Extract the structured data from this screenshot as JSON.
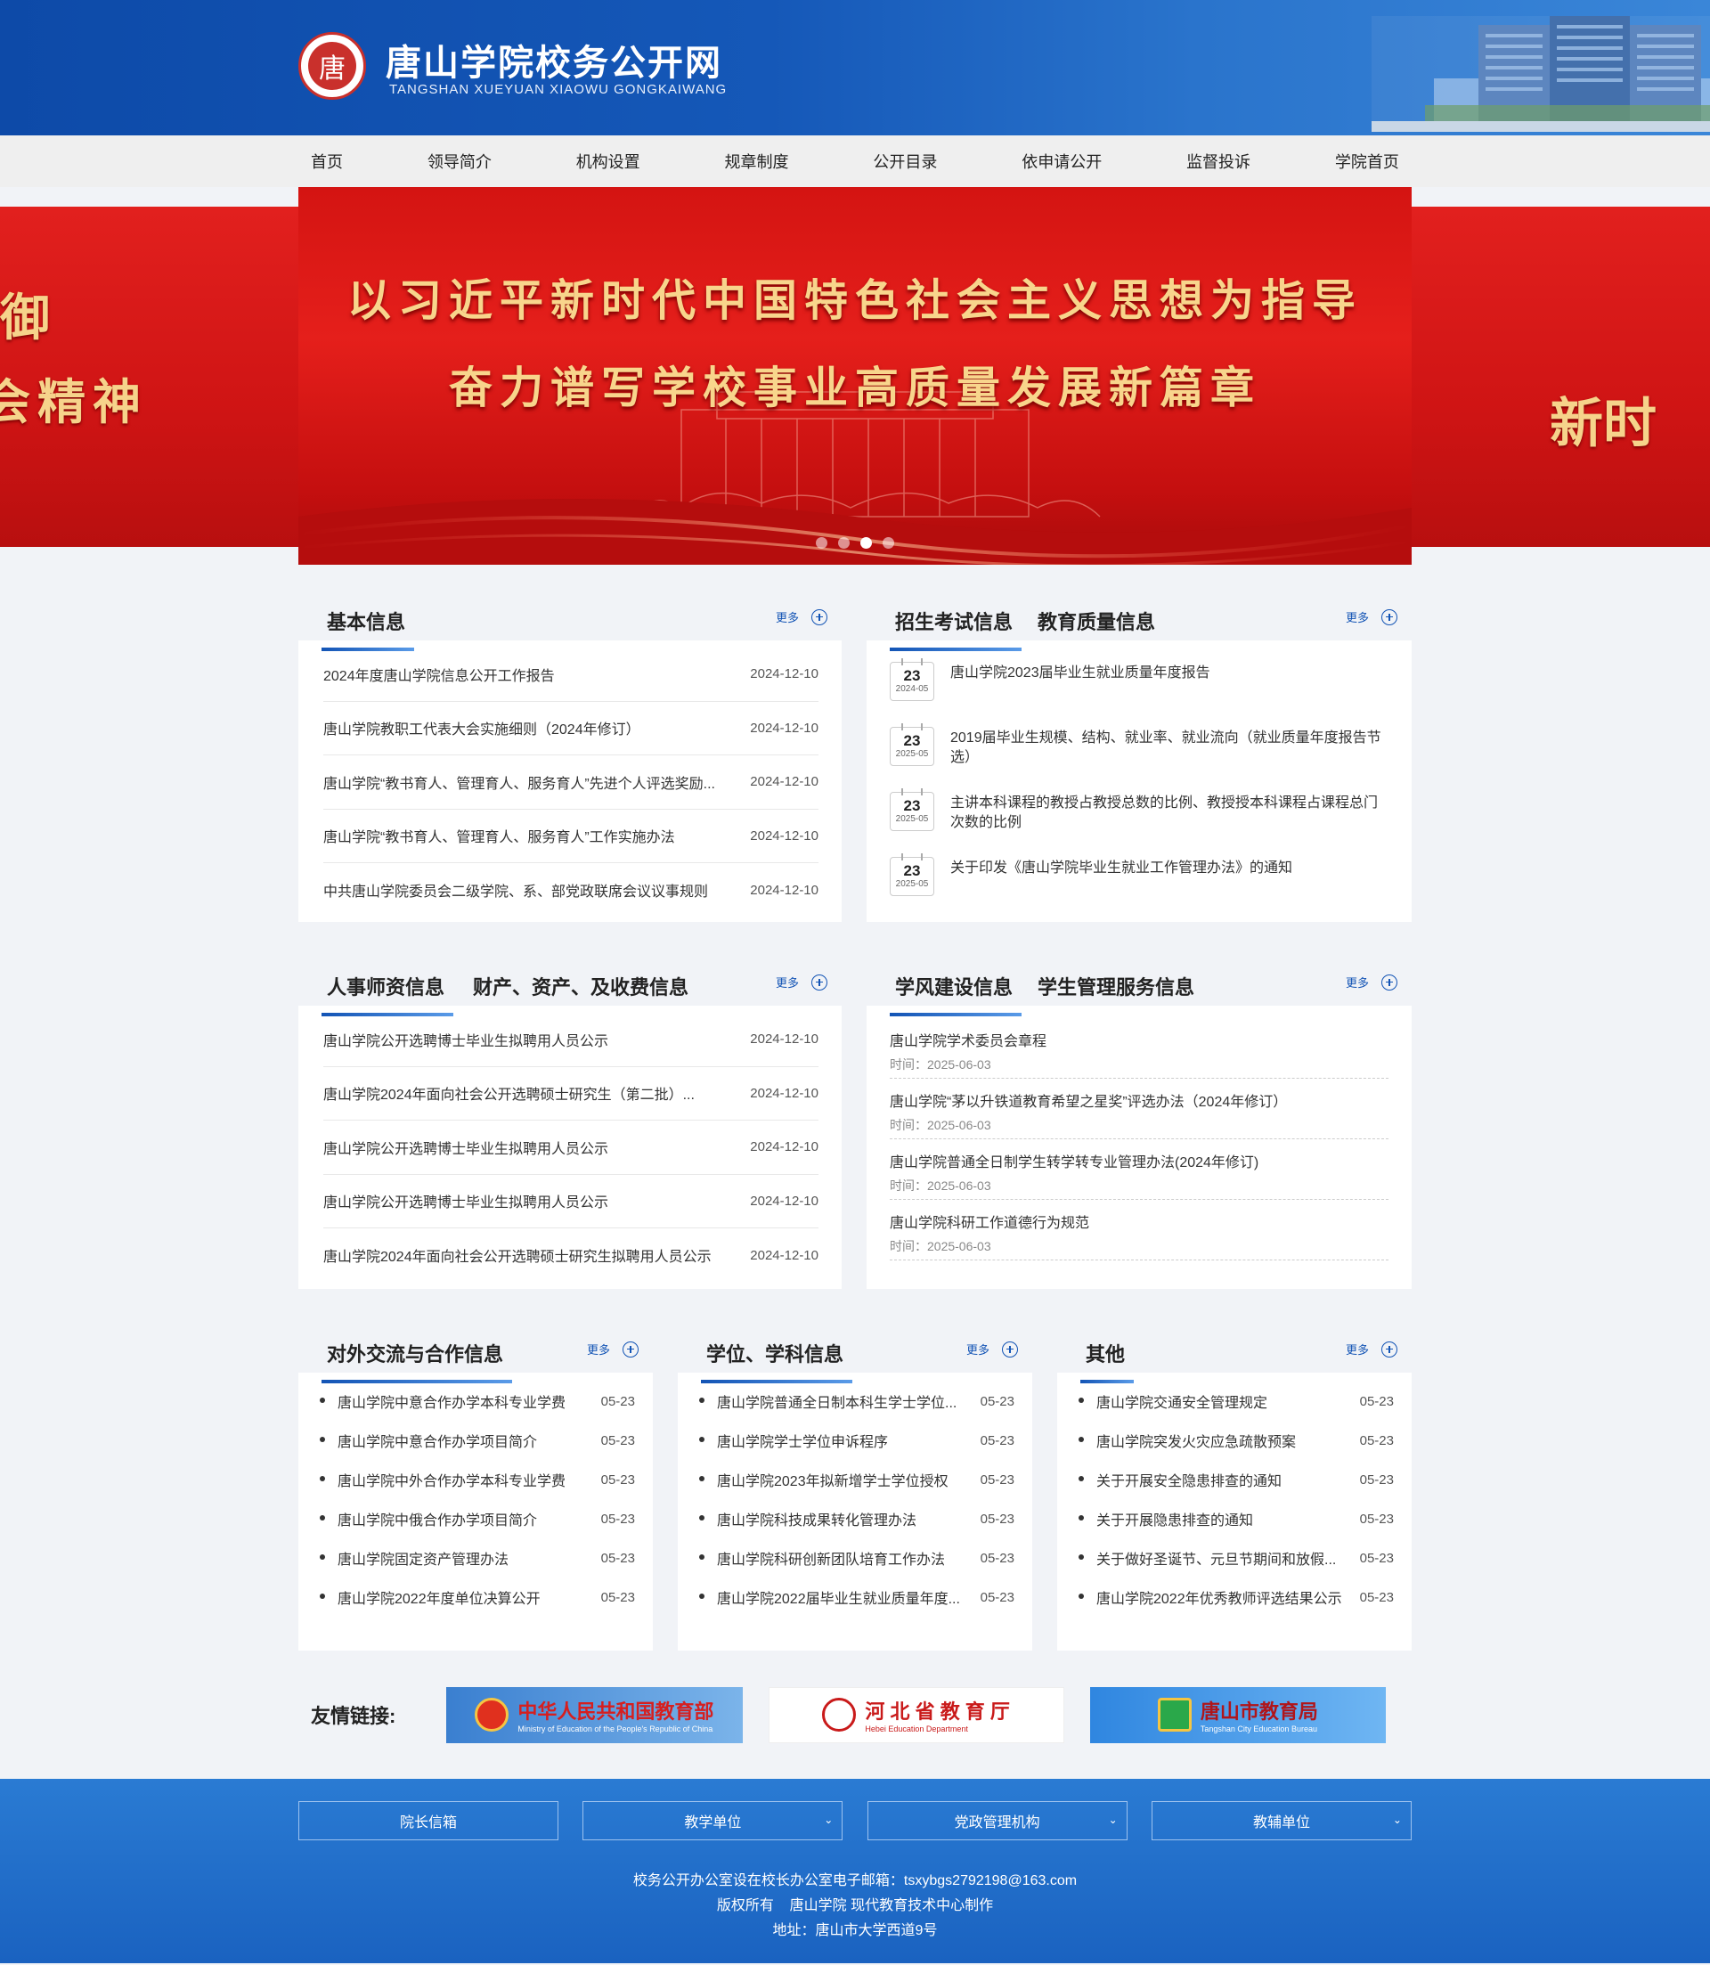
{
  "header": {
    "logo_char": "唐",
    "title": "唐山学院校务公开网",
    "subtitle": "TANGSHAN  XUEYUAN  XIAOWU  GONGKAIWANG"
  },
  "nav": [
    "首页",
    "领导简介",
    "机构设置",
    "规章制度",
    "公开目录",
    "依申请公开",
    "监督投诉",
    "学院首页"
  ],
  "banner": {
    "line1": "以习近平新时代中国特色社会主义思想为指导",
    "line2": "奋力谱写学校事业高质量发展新篇章",
    "left_text_1": "御",
    "left_text_2": "会精神",
    "right_text": "新时",
    "slides": 4,
    "active_slide": 3
  },
  "more_label": "更多",
  "basic_info": {
    "title": "基本信息",
    "items": [
      {
        "title": "2024年度唐山学院信息公开工作报告",
        "date": "2024-12-10"
      },
      {
        "title": "唐山学院教职工代表大会实施细则（2024年修订）",
        "date": "2024-12-10"
      },
      {
        "title": "唐山学院“教书育人、管理育人、服务育人”先进个人评选奖励...",
        "date": "2024-12-10"
      },
      {
        "title": "唐山学院“教书育人、管理育人、服务育人”工作实施办法",
        "date": "2024-12-10"
      },
      {
        "title": "中共唐山学院委员会二级学院、系、部党政联席会议议事规则",
        "date": "2024-12-10"
      }
    ]
  },
  "admission": {
    "tabs": [
      "招生考试信息",
      "教育质量信息"
    ],
    "items": [
      {
        "day": "23",
        "ym": "2024-05",
        "title": "唐山学院2023届毕业生就业质量年度报告"
      },
      {
        "day": "23",
        "ym": "2025-05",
        "title": "2019届毕业生规模、结构、就业率、就业流向（就业质量年度报告节选）"
      },
      {
        "day": "23",
        "ym": "2025-05",
        "title": "主讲本科课程的教授占教授总数的比例、教授授本科课程占课程总门次数的比例"
      },
      {
        "day": "23",
        "ym": "2025-05",
        "title": "关于印发《唐山学院毕业生就业工作管理办法》的通知"
      }
    ]
  },
  "personnel": {
    "tabs": [
      "人事师资信息",
      "财产、资产、及收费信息"
    ],
    "items": [
      {
        "title": "唐山学院公开选聘博士毕业生拟聘用人员公示",
        "date": "2024-12-10"
      },
      {
        "title": "唐山学院2024年面向社会公开选聘硕士研究生（第二批）...",
        "date": "2024-12-10"
      },
      {
        "title": "唐山学院公开选聘博士毕业生拟聘用人员公示",
        "date": "2024-12-10"
      },
      {
        "title": "唐山学院公开选聘博士毕业生拟聘用人员公示",
        "date": "2024-12-10"
      },
      {
        "title": "唐山学院2024年面向社会公开选聘硕士研究生拟聘用人员公示",
        "date": "2024-12-10"
      }
    ]
  },
  "study": {
    "tabs": [
      "学风建设信息",
      "学生管理服务信息"
    ],
    "time_label": "时间：",
    "items": [
      {
        "title": "唐山学院学术委员会章程",
        "time": "2025-06-03"
      },
      {
        "title": "唐山学院“茅以升铁道教育希望之星奖”评选办法（2024年修订）",
        "time": "2025-06-03"
      },
      {
        "title": "唐山学院普通全日制学生转学转专业管理办法(2024年修订)",
        "time": "2025-06-03"
      },
      {
        "title": "唐山学院科研工作道德行为规范",
        "time": "2025-06-03"
      }
    ]
  },
  "exchange": {
    "title": "对外交流与合作信息",
    "items": [
      {
        "title": "唐山学院中意合作办学本科专业学费",
        "date": "05-23"
      },
      {
        "title": "唐山学院中意合作办学项目简介",
        "date": "05-23"
      },
      {
        "title": "唐山学院中外合作办学本科专业学费",
        "date": "05-23"
      },
      {
        "title": "唐山学院中俄合作办学项目简介",
        "date": "05-23"
      },
      {
        "title": "唐山学院固定资产管理办法",
        "date": "05-23"
      },
      {
        "title": "唐山学院2022年度单位决算公开",
        "date": "05-23"
      }
    ]
  },
  "degree": {
    "title": "学位、学科信息",
    "items": [
      {
        "title": "唐山学院普通全日制本科生学士学位...",
        "date": "05-23"
      },
      {
        "title": "唐山学院学士学位申诉程序",
        "date": "05-23"
      },
      {
        "title": "唐山学院2023年拟新增学士学位授权",
        "date": "05-23"
      },
      {
        "title": "唐山学院科技成果转化管理办法",
        "date": "05-23"
      },
      {
        "title": "唐山学院科研创新团队培育工作办法",
        "date": "05-23"
      },
      {
        "title": "唐山学院2022届毕业生就业质量年度...",
        "date": "05-23"
      }
    ]
  },
  "other": {
    "title": "其他",
    "items": [
      {
        "title": "唐山学院交通安全管理规定",
        "date": "05-23"
      },
      {
        "title": "唐山学院突发火灾应急疏散预案",
        "date": "05-23"
      },
      {
        "title": "关于开展安全隐患排查的通知",
        "date": "05-23"
      },
      {
        "title": "关于开展隐患排查的通知",
        "date": "05-23"
      },
      {
        "title": "关于做好圣诞节、元旦节期间和放假...",
        "date": "05-23"
      },
      {
        "title": "唐山学院2022年优秀教师评选结果公示",
        "date": "05-23"
      }
    ]
  },
  "links": {
    "label": "友情链接:",
    "items": [
      {
        "name": "中华人民共和国教育部",
        "sub": "Ministry of Education of the People's Republic of China"
      },
      {
        "name": "河 北 省 教 育 厅",
        "sub": "Hebei Education Department"
      },
      {
        "name": "唐山市教育局",
        "sub": "Tangshan City Education Bureau"
      }
    ]
  },
  "footer": {
    "selects": [
      "院长信箱",
      "教学单位",
      "党政管理机构",
      "教辅单位"
    ],
    "line1": "校务公开办公室设在校长办公室电子邮箱：tsxybgs2792198@163.com",
    "line2": "版权所有    唐山学院 现代教育技术中心制作",
    "line3": "地址：唐山市大学西道9号"
  },
  "colors": {
    "primary": "#1354b5",
    "banner_red": "#d41412",
    "gold": "#f8d58c"
  }
}
